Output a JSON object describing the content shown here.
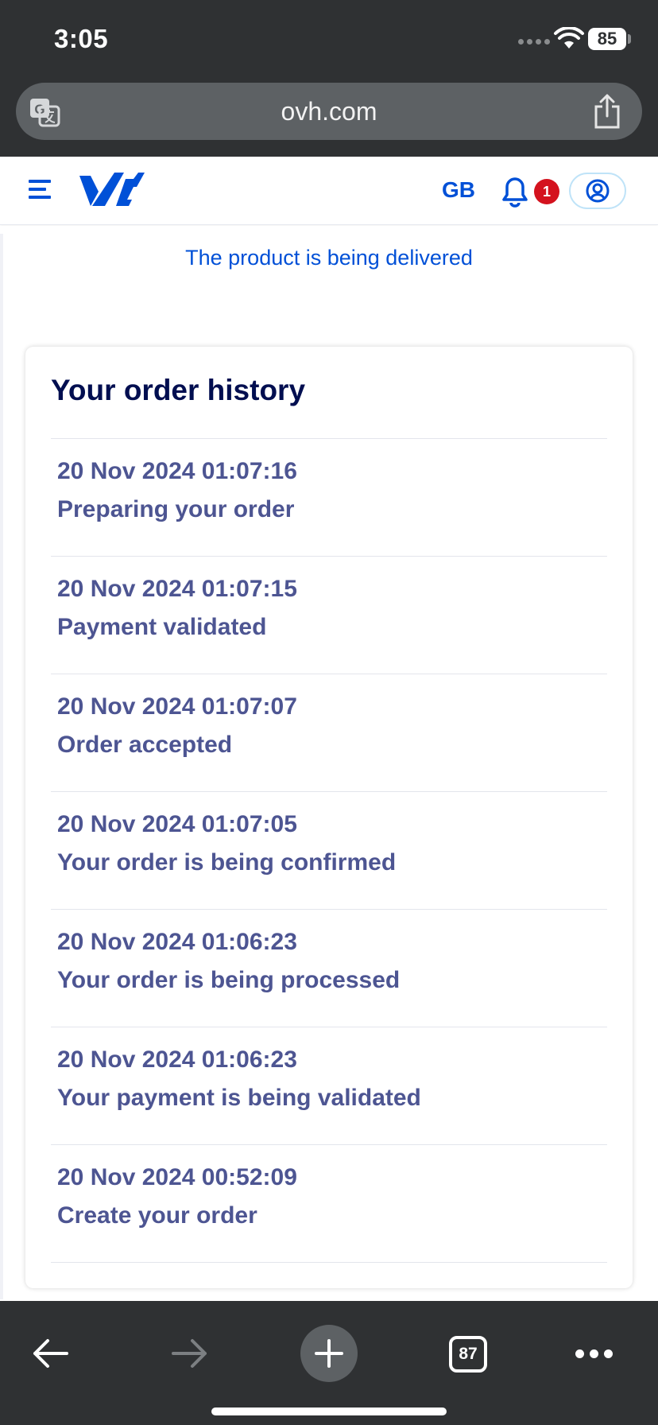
{
  "status_bar": {
    "time": "3:05",
    "battery": "85"
  },
  "browser": {
    "url": "ovh.com",
    "open_tabs": "87"
  },
  "header": {
    "language": "GB",
    "notification_count": "1"
  },
  "banner": {
    "text": "The product is being delivered"
  },
  "order_history": {
    "title": "Your order history",
    "items": [
      {
        "date": "20 Nov 2024 01:07:16",
        "status": "Preparing your order"
      },
      {
        "date": "20 Nov 2024 01:07:15",
        "status": "Payment validated"
      },
      {
        "date": "20 Nov 2024 01:07:07",
        "status": "Order accepted"
      },
      {
        "date": "20 Nov 2024 01:07:05",
        "status": "Your order is being confirmed"
      },
      {
        "date": "20 Nov 2024 01:06:23",
        "status": "Your order is being processed"
      },
      {
        "date": "20 Nov 2024 01:06:23",
        "status": "Your payment is being validated"
      },
      {
        "date": "20 Nov 2024 00:52:09",
        "status": "Create your order"
      }
    ]
  },
  "icons": {
    "translate": "translate-icon",
    "share": "share-icon",
    "menu": "hamburger-menu-icon",
    "notifications": "bell-icon",
    "account": "user-account-icon",
    "back": "arrow-left-icon",
    "forward": "arrow-right-icon",
    "new_tab": "plus-icon",
    "more": "more-dots-icon"
  },
  "colors": {
    "brand_blue": "#0050d7",
    "heading_navy": "#000e50",
    "history_text": "#4d5592",
    "badge_red": "#d4121e",
    "chrome_dark": "#2f3133"
  }
}
